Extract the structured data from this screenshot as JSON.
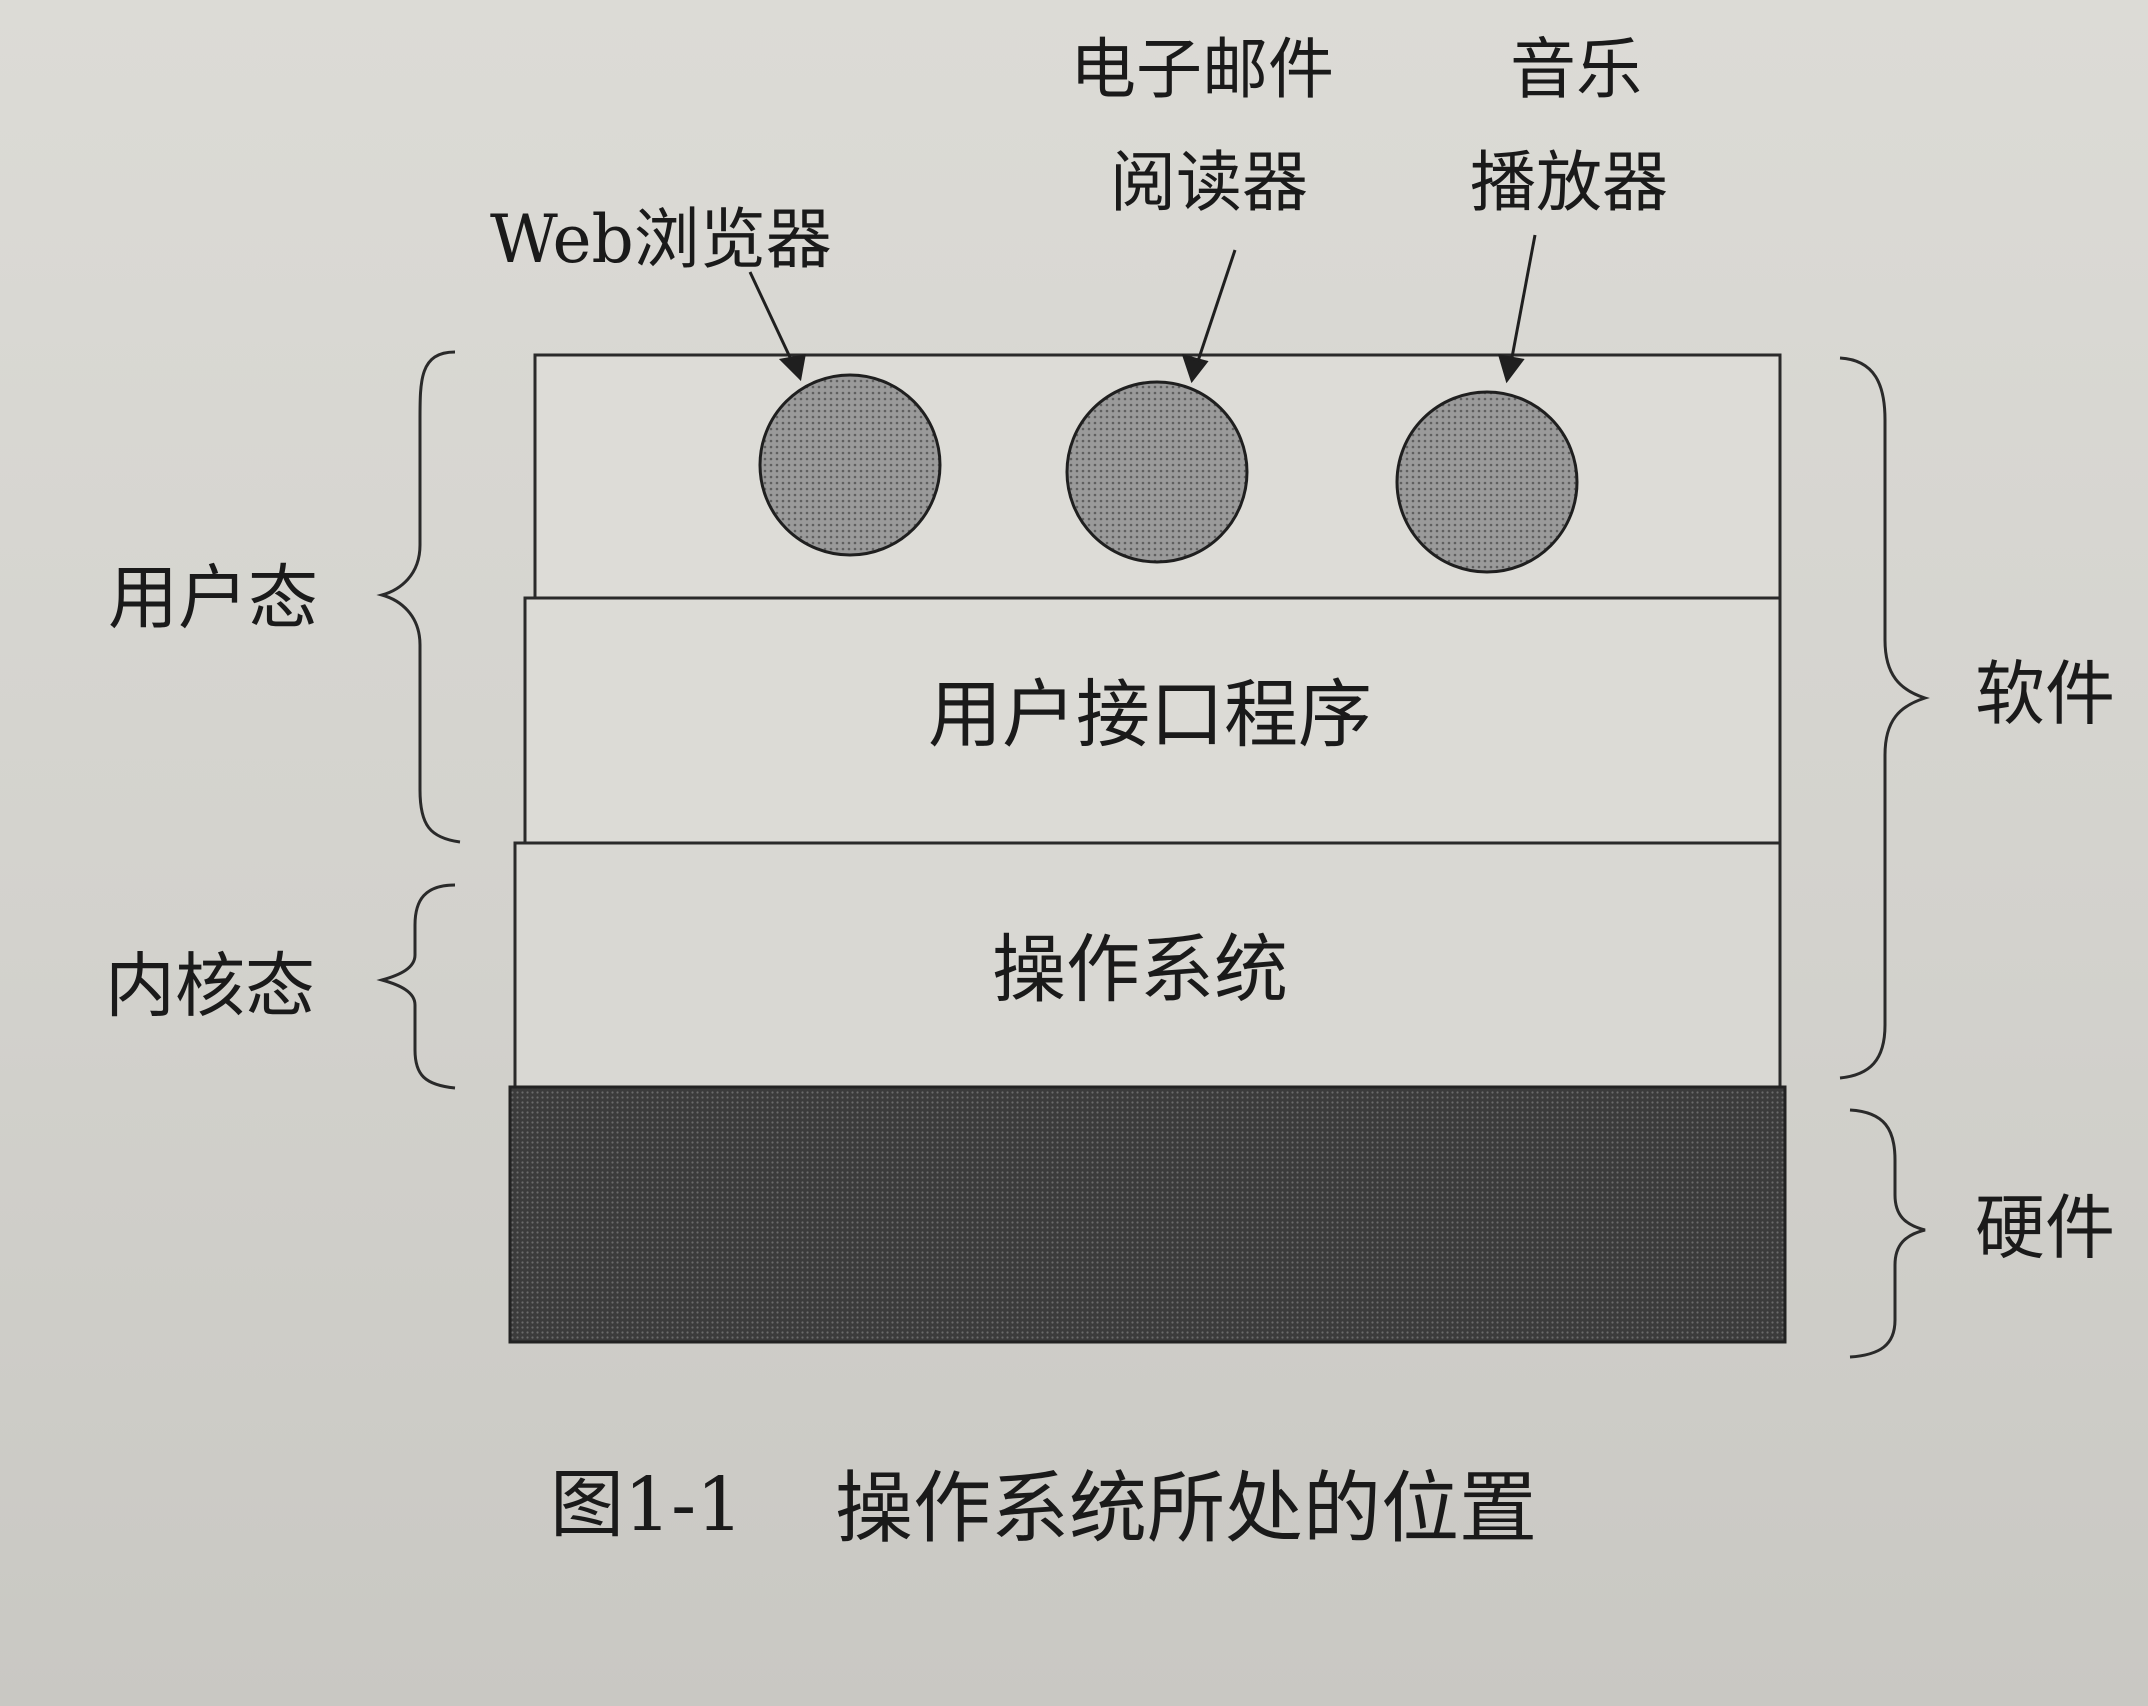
{
  "diagram": {
    "app_labels": {
      "browser": "Web浏览器",
      "email_line1": "电子邮件",
      "email_line2": "阅读器",
      "music_line1": "音乐",
      "music_line2": "播放器"
    },
    "layers": {
      "ui_program": "用户接口程序",
      "os": "操作系统"
    },
    "modes": {
      "user_mode": "用户态",
      "kernel_mode": "内核态"
    },
    "categories": {
      "software": "软件",
      "hardware": "硬件"
    },
    "caption": {
      "number": "图1-1",
      "text": "操作系统所处的位置"
    },
    "colors": {
      "app_circle_fill": "#8e8e8e",
      "hardware_fill": "#3a3a3a",
      "line": "#2a2a2a",
      "layer_fill": "#dcdbd6"
    }
  }
}
